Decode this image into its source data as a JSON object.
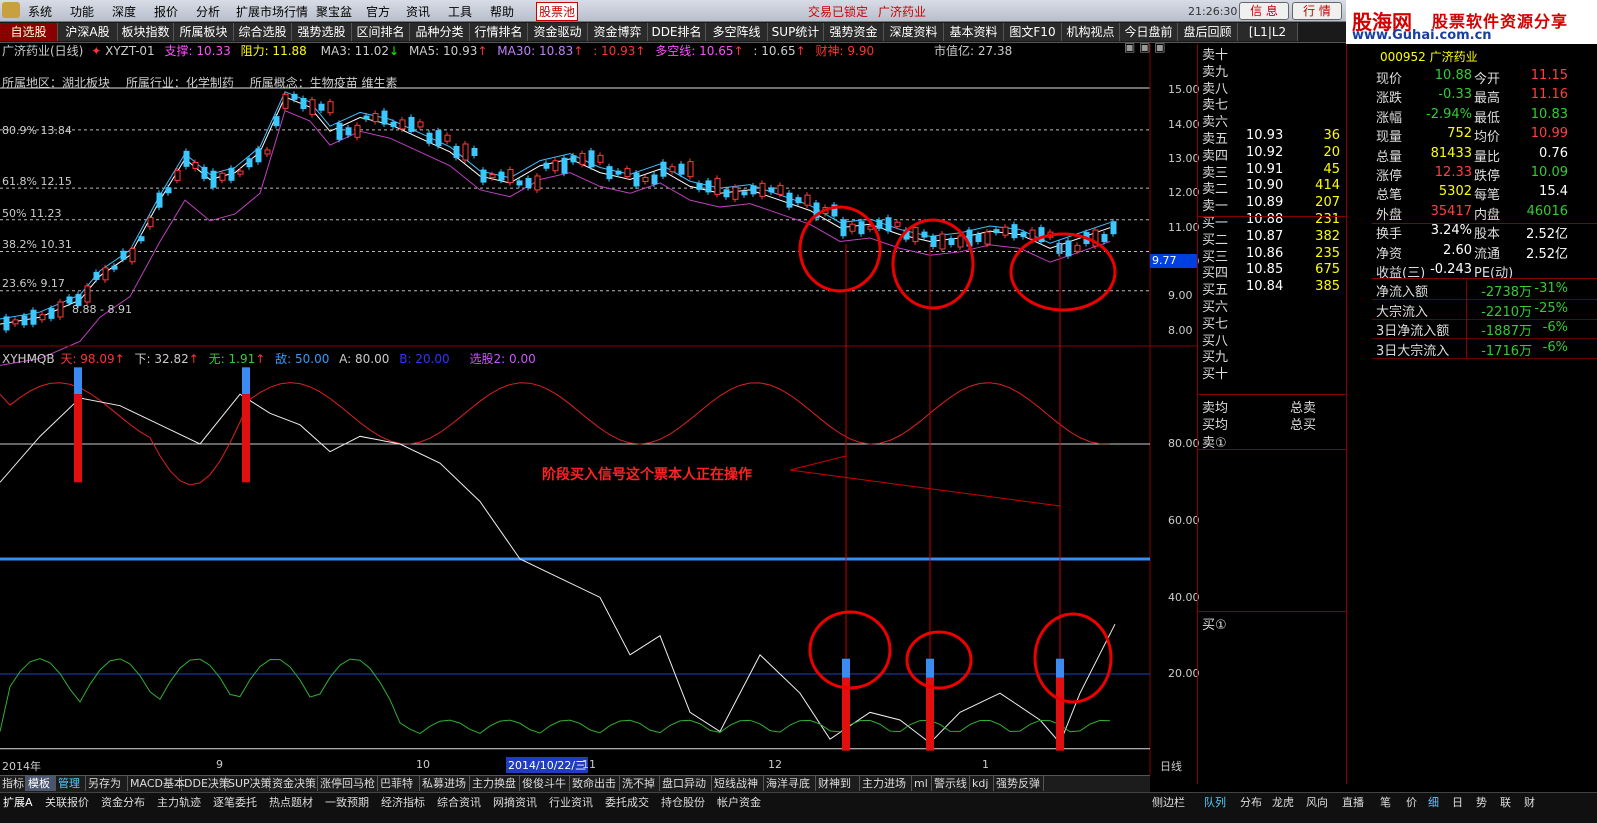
{
  "menu": {
    "items": [
      "系统",
      "功能",
      "深度",
      "报价",
      "分析",
      "扩展市场行情",
      "聚宝盆",
      "官方",
      "资讯",
      "工具",
      "帮助"
    ],
    "stock_pool": "股票池",
    "trade_status": "交易已锁定",
    "stock_name": "广济药业",
    "clock": "21:26:30 周五",
    "btn_info": "信 息",
    "btn_quote": "行 情"
  },
  "logo": {
    "name": "股海网",
    "slogan": "股票软件资源分享",
    "url": "www.Guhai.com.cn"
  },
  "tabs": [
    "自选股",
    "沪深A股",
    "板块指数",
    "所属板块",
    "综合选股",
    "强势选股",
    "区间排名",
    "品种分类",
    "行情排名",
    "资金驱动",
    "资金博弈",
    "DDE排名",
    "多空阵线",
    "SUP统计",
    "强势资金",
    "深度资料",
    "基本资料",
    "图文F10",
    "机构视点",
    "今日盘前",
    "盘后回顾",
    "[L1|L2"
  ],
  "chart_header": {
    "title": "广济药业(日线)",
    "indicator": "XYZT-01",
    "support": "支撑: 10.33",
    "resistance": "阻力: 11.88",
    "ma3": "MA3: 11.02",
    "ma5": "MA5: 10.93",
    "ma30": "MA30: 10.83",
    "v1": ": 10.93",
    "duokong": "多空线: 10.65",
    "v2": ": 10.65",
    "caishen": "财神: 9.90",
    "mktcap": "市值亿: 27.38"
  },
  "sector_line": {
    "region": "所属地区：湖北板块",
    "industry": "所属行业：化学制药",
    "concept": "所属概念：生物疫苗 维生素"
  },
  "price_axis": [
    "15.00",
    "14.00",
    "13.00",
    "12.00",
    "11.00",
    "10.00",
    "9.00",
    "8.00"
  ],
  "current_price_tag": "9.77",
  "fib_labels": [
    "80.9% 13.84",
    "61.8% 12.15",
    "50% 11.23",
    "38.2% 10.31",
    "23.6% 9.17"
  ],
  "low_range": "8.88 - 8.91",
  "ind_header": {
    "name": "XYHMQB",
    "tian": "天: 98.09",
    "xia": "下: 32.82",
    "wu": "无: 1.91",
    "di": "敌: 50.00",
    "a": "A: 80.00",
    "b": "B: 20.00",
    "xuangu": "选股2: 0.00"
  },
  "ind_axis": [
    "80.00",
    "60.00",
    "40.00",
    "20.00"
  ],
  "annotation": "阶段买入信号这个票本人正在操作",
  "date_axis": {
    "year": "2014年",
    "m9": "9",
    "m10": "10",
    "m11": "11",
    "m12": "12",
    "m1": "1",
    "cursor_date": "2014/10/22/三",
    "period": "日线"
  },
  "orderbook": {
    "sells": [
      {
        "label": "卖十",
        "price": "",
        "vol": ""
      },
      {
        "label": "卖九",
        "price": "",
        "vol": ""
      },
      {
        "label": "卖八",
        "price": "",
        "vol": ""
      },
      {
        "label": "卖七",
        "price": "",
        "vol": ""
      },
      {
        "label": "卖六",
        "price": "",
        "vol": ""
      },
      {
        "label": "卖五",
        "price": "10.93",
        "vol": "36"
      },
      {
        "label": "卖四",
        "price": "10.92",
        "vol": "20"
      },
      {
        "label": "卖三",
        "price": "10.91",
        "vol": "45"
      },
      {
        "label": "卖二",
        "price": "10.90",
        "vol": "414"
      },
      {
        "label": "卖一",
        "price": "10.89",
        "vol": "207"
      }
    ],
    "buys": [
      {
        "label": "买一",
        "price": "10.88",
        "vol": "231"
      },
      {
        "label": "买二",
        "price": "10.87",
        "vol": "382"
      },
      {
        "label": "买三",
        "price": "10.86",
        "vol": "235"
      },
      {
        "label": "买四",
        "price": "10.85",
        "vol": "675"
      },
      {
        "label": "买五",
        "price": "10.84",
        "vol": "385"
      },
      {
        "label": "买六",
        "price": "",
        "vol": ""
      },
      {
        "label": "买七",
        "price": "",
        "vol": ""
      },
      {
        "label": "买八",
        "price": "",
        "vol": ""
      },
      {
        "label": "买九",
        "price": "",
        "vol": ""
      },
      {
        "label": "买十",
        "price": "",
        "vol": ""
      }
    ],
    "sell_avg": "卖均",
    "buy_avg": "买均",
    "total_sell": "总卖",
    "total_buy": "总买",
    "sell_detail": "卖①",
    "buy_detail": "买①"
  },
  "stats": {
    "code_line": "000952 广济药业",
    "rows": [
      [
        "现价",
        "10.88",
        "今开",
        "11.15"
      ],
      [
        "涨跌",
        "-0.33",
        "最高",
        "11.16"
      ],
      [
        "涨幅",
        "-2.94%",
        "最低",
        "10.83"
      ],
      [
        "现量",
        "752",
        "均价",
        "10.99"
      ],
      [
        "总量",
        "81433",
        "量比",
        "0.76"
      ],
      [
        "涨停",
        "12.33",
        "跌停",
        "10.09"
      ],
      [
        "总笔",
        "5302",
        "每笔",
        "15.4"
      ],
      [
        "外盘",
        "35417",
        "内盘",
        "46016"
      ],
      [
        "换手",
        "3.24%",
        "股本",
        "2.52亿"
      ],
      [
        "净资",
        "2.60",
        "流通",
        "2.52亿"
      ],
      [
        "收益(三)",
        "-0.243",
        "PE(动)",
        ""
      ]
    ],
    "flows": [
      [
        "净流入额",
        "-2738万",
        "-31%"
      ],
      [
        "大宗流入",
        "-2210万",
        "-25%"
      ],
      [
        "3日净流入额",
        "-1887万",
        "-6%"
      ],
      [
        "3日大宗流入",
        "-1716万",
        "-6%"
      ]
    ]
  },
  "bottom_tabs": [
    "指标",
    "模板",
    "管理",
    "另存为",
    "MACD基本",
    "DDE决策",
    "SUP决策",
    "资金决策",
    "涨停回马枪",
    "巴菲特",
    "私募进场",
    "主力换盘",
    "俊俊斗牛",
    "致命出击",
    "洗不掉",
    "盘口异动",
    "短线战神",
    "海洋寻底",
    "财神到",
    "主力进场",
    "ml",
    "警示线",
    "kdj",
    "强势反弹"
  ],
  "footer_tabs": [
    "扩展A",
    "关联报价",
    "资金分布",
    "主力轨迹",
    "逐笔委托",
    "热点题材",
    "一致预期",
    "经济指标",
    "综合资讯",
    "网摘资讯",
    "行业资讯",
    "委托成交",
    "持仓股份",
    "帐户资金"
  ],
  "footer_right": [
    "侧边栏",
    "队列",
    "分布",
    "龙虎",
    "风向",
    "直播",
    "笔",
    "价",
    "细",
    "日",
    "势",
    "联",
    "财"
  ]
}
